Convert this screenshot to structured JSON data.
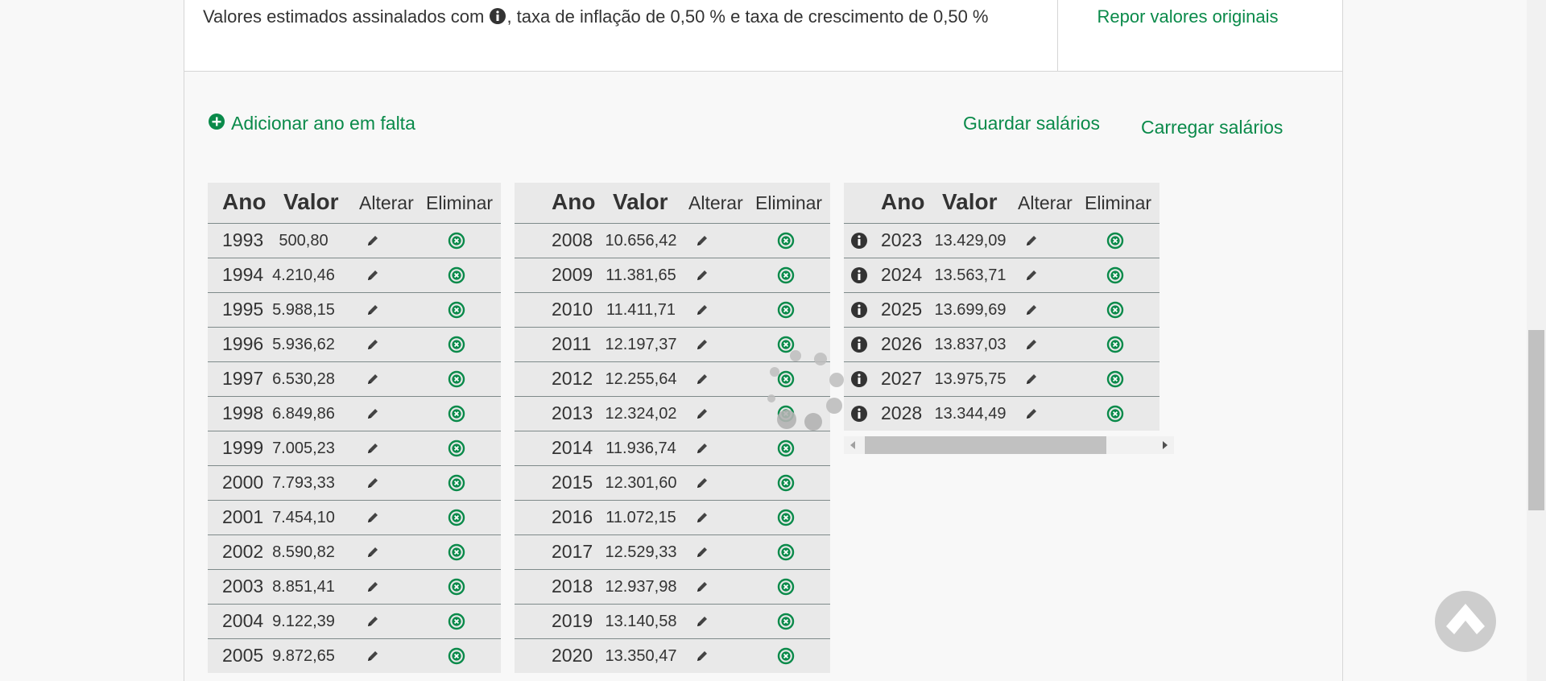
{
  "header": {
    "info_text_before": "Valores estimados assinalados com",
    "info_text_after": ", taxa de inflação de 0,50 %  e taxa de crescimento de 0,50 %",
    "reset_link": "Repor valores originais"
  },
  "actions": {
    "add_year": "Adicionar ano em falta",
    "save_salaries": "Guardar salários",
    "load_salaries": "Carregar salários"
  },
  "table_headers": {
    "year": "Ano",
    "value": "Valor",
    "edit": "Alterar",
    "delete": "Eliminar"
  },
  "tables": [
    {
      "rows": [
        {
          "year": "1993",
          "value": "500,80"
        },
        {
          "year": "1994",
          "value": "4.210,46"
        },
        {
          "year": "1995",
          "value": "5.988,15"
        },
        {
          "year": "1996",
          "value": "5.936,62"
        },
        {
          "year": "1997",
          "value": "6.530,28"
        },
        {
          "year": "1998",
          "value": "6.849,86"
        },
        {
          "year": "1999",
          "value": "7.005,23"
        },
        {
          "year": "2000",
          "value": "7.793,33"
        },
        {
          "year": "2001",
          "value": "7.454,10"
        },
        {
          "year": "2002",
          "value": "8.590,82"
        },
        {
          "year": "2003",
          "value": "8.851,41"
        },
        {
          "year": "2004",
          "value": "9.122,39"
        },
        {
          "year": "2005",
          "value": "9.872,65"
        }
      ]
    },
    {
      "rows": [
        {
          "year": "2008",
          "value": "10.656,42"
        },
        {
          "year": "2009",
          "value": "11.381,65"
        },
        {
          "year": "2010",
          "value": "11.411,71"
        },
        {
          "year": "2011",
          "value": "12.197,37"
        },
        {
          "year": "2012",
          "value": "12.255,64"
        },
        {
          "year": "2013",
          "value": "12.324,02"
        },
        {
          "year": "2014",
          "value": "11.936,74"
        },
        {
          "year": "2015",
          "value": "12.301,60"
        },
        {
          "year": "2016",
          "value": "11.072,15"
        },
        {
          "year": "2017",
          "value": "12.529,33"
        },
        {
          "year": "2018",
          "value": "12.937,98"
        },
        {
          "year": "2019",
          "value": "13.140,58"
        },
        {
          "year": "2020",
          "value": "13.350,47"
        }
      ]
    },
    {
      "rows": [
        {
          "year": "2023",
          "value": "13.429,09",
          "estimated": true
        },
        {
          "year": "2024",
          "value": "13.563,71",
          "estimated": true
        },
        {
          "year": "2025",
          "value": "13.699,69",
          "estimated": true
        },
        {
          "year": "2026",
          "value": "13.837,03",
          "estimated": true
        },
        {
          "year": "2027",
          "value": "13.975,75",
          "estimated": true
        },
        {
          "year": "2028",
          "value": "13.344,49",
          "estimated": true
        }
      ]
    }
  ],
  "colors": {
    "accent": "#0a8a4a",
    "row_bg": "#e9e9e9",
    "row_border": "#7e8a8a"
  }
}
